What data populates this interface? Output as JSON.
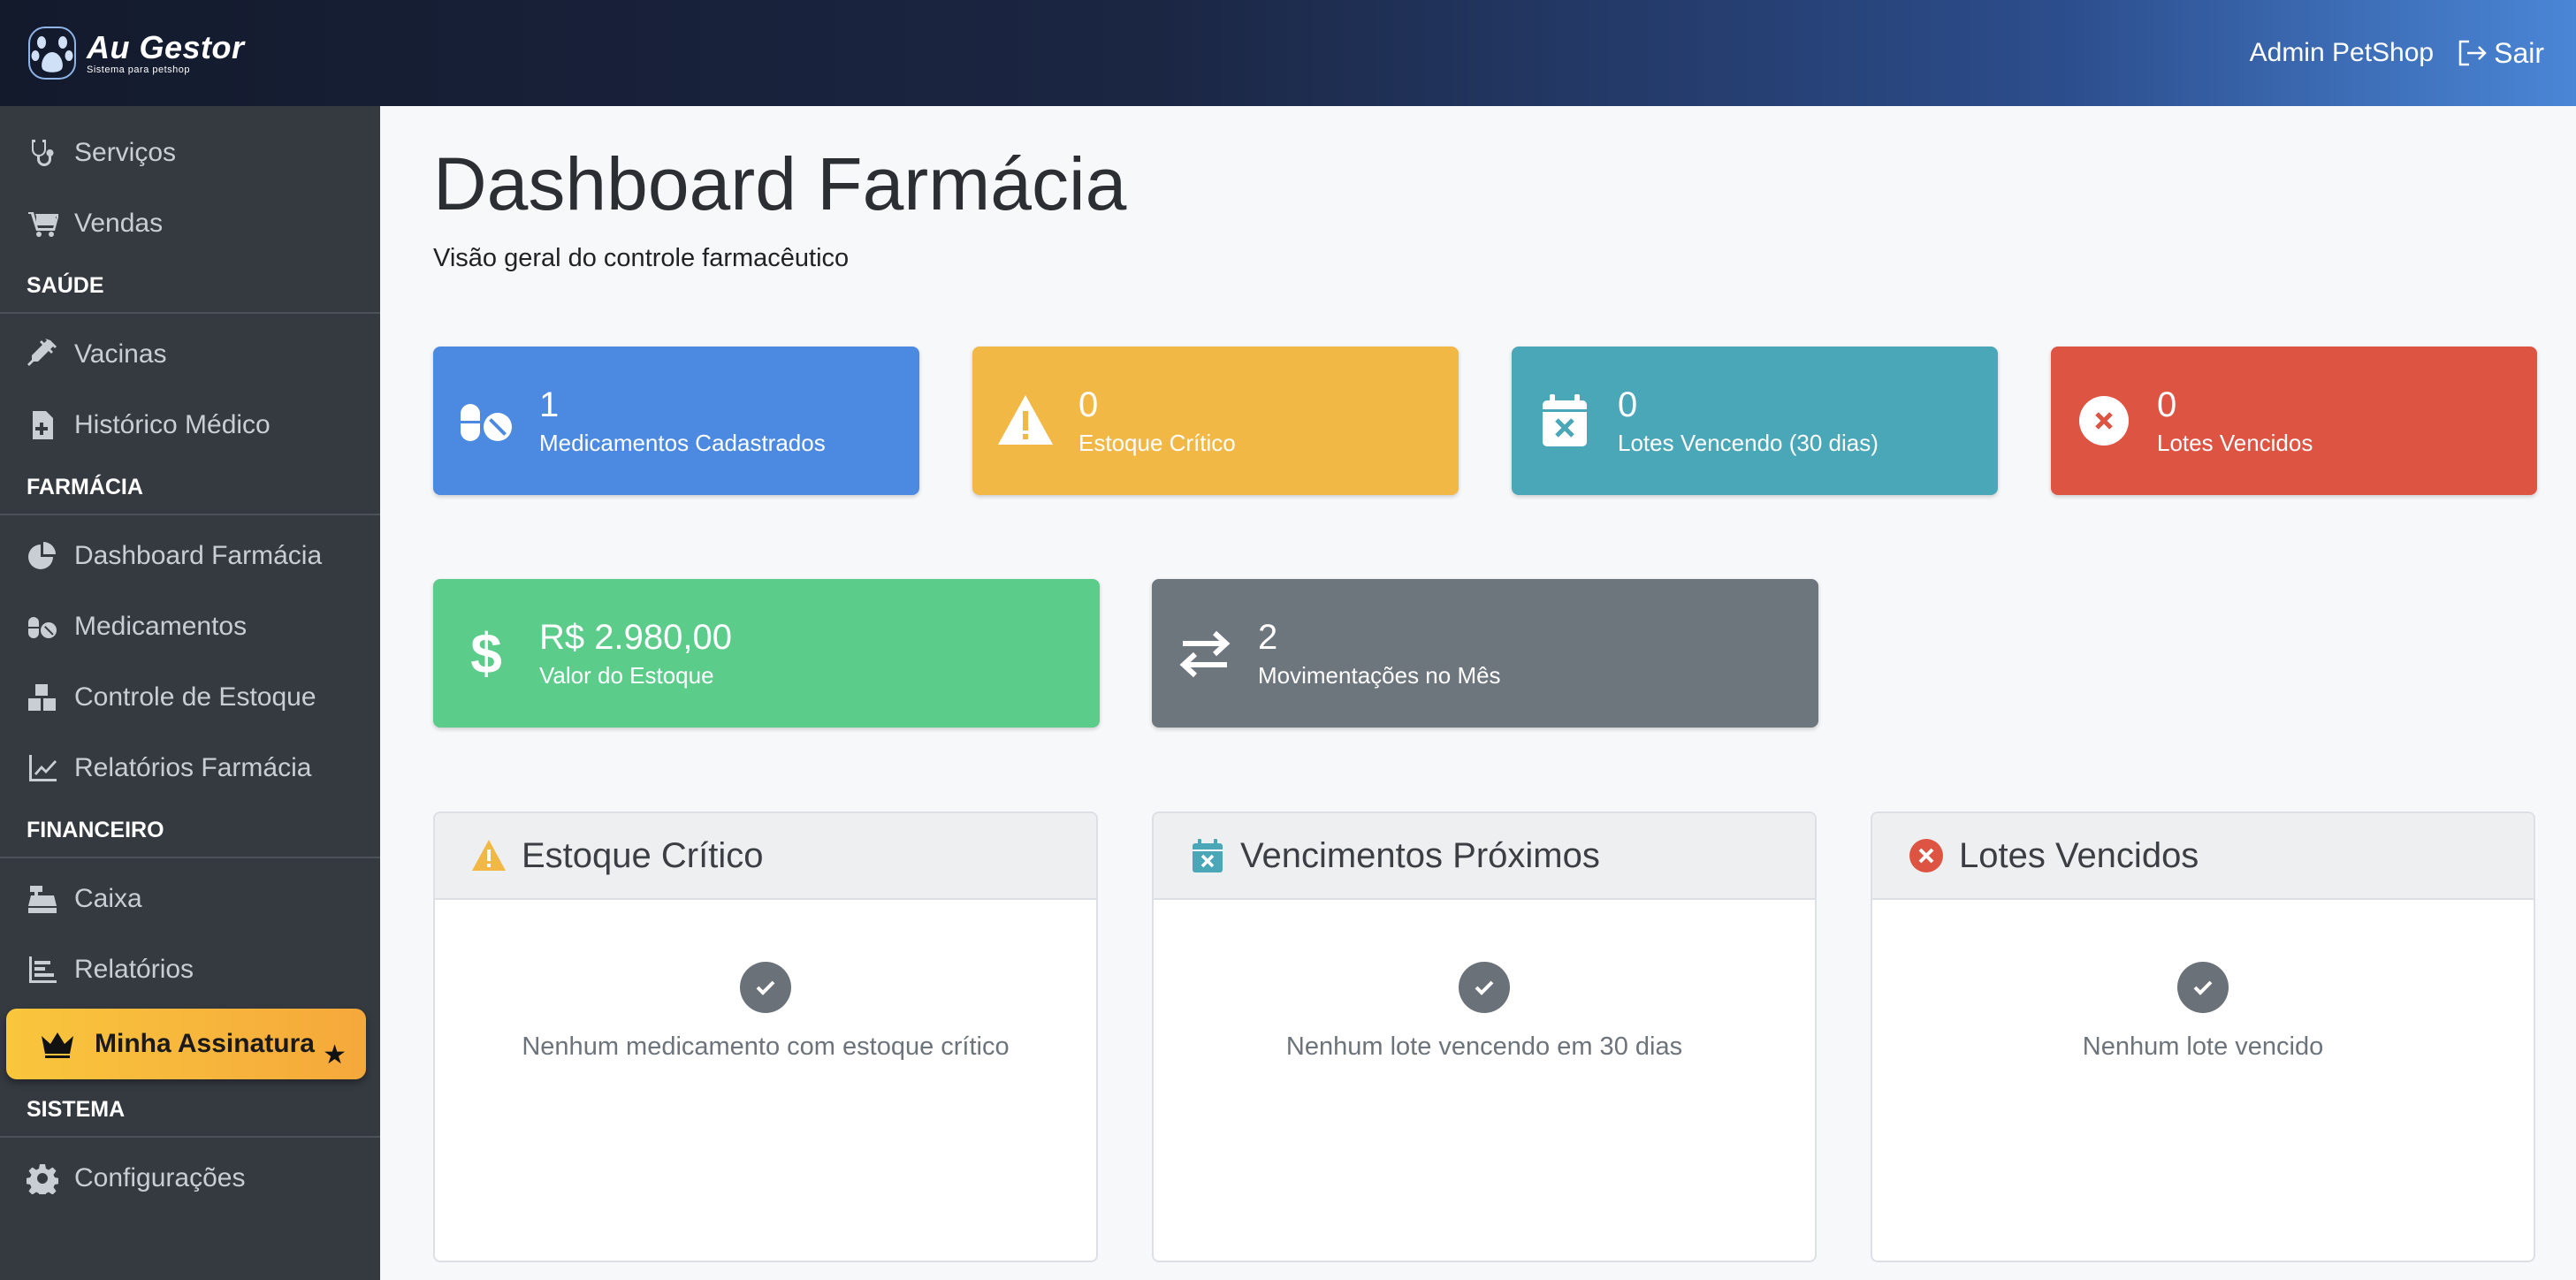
{
  "header": {
    "brand_name": "Au Gestor",
    "brand_tagline": "Sistema para petshop",
    "user_name": "Admin PetShop",
    "logout_label": "Sair"
  },
  "sidebar": {
    "items_top": [
      {
        "label": "Serviços",
        "icon": "stethoscope-icon"
      },
      {
        "label": "Vendas",
        "icon": "cart-icon"
      }
    ],
    "sections": [
      {
        "title": "SAÚDE",
        "items": [
          {
            "label": "Vacinas",
            "icon": "syringe-icon"
          },
          {
            "label": "Histórico Médico",
            "icon": "medical-file-icon"
          }
        ]
      },
      {
        "title": "FARMÁCIA",
        "items": [
          {
            "label": "Dashboard Farmácia",
            "icon": "pie-chart-icon"
          },
          {
            "label": "Medicamentos",
            "icon": "pills-icon"
          },
          {
            "label": "Controle de Estoque",
            "icon": "boxes-icon"
          },
          {
            "label": "Relatórios Farmácia",
            "icon": "line-chart-icon"
          }
        ]
      },
      {
        "title": "FINANCEIRO",
        "items": [
          {
            "label": "Caixa",
            "icon": "cash-register-icon"
          },
          {
            "label": "Relatórios",
            "icon": "bar-chart-icon"
          }
        ]
      },
      {
        "title": "SISTEMA",
        "items": [
          {
            "label": "Configurações",
            "icon": "gear-icon"
          }
        ]
      }
    ],
    "premium": {
      "label": "Minha Assinatura",
      "star": "★"
    }
  },
  "page": {
    "title": "Dashboard Farmácia",
    "subtitle": "Visão geral do controle farmacêutico"
  },
  "stats": [
    {
      "value": "1",
      "label": "Medicamentos Cadastrados",
      "color": "#4b8ae0",
      "icon": "pills-icon"
    },
    {
      "value": "0",
      "label": "Estoque Crítico",
      "color": "#f2b845",
      "icon": "warning-icon"
    },
    {
      "value": "0",
      "label": "Lotes Vencendo (30 dias)",
      "color": "#4aa7b8",
      "icon": "calendar-x-icon"
    },
    {
      "value": "0",
      "label": "Lotes Vencidos",
      "color": "#dd5442",
      "icon": "x-circle-icon"
    },
    {
      "value": "R$ 2.980,00",
      "label": "Valor do Estoque",
      "color": "#5ccc8b",
      "icon": "dollar-icon"
    },
    {
      "value": "2",
      "label": "Movimentações no Mês",
      "color": "#6d757d",
      "icon": "exchange-icon"
    }
  ],
  "panels": [
    {
      "title": "Estoque Crítico",
      "message": "Nenhum medicamento com estoque crítico",
      "icon": "warning-icon",
      "icon_color": "#f2b845"
    },
    {
      "title": "Vencimentos Próximos",
      "message": "Nenhum lote vencendo em 30 dias",
      "icon": "calendar-x-icon",
      "icon_color": "#4aa7b8"
    },
    {
      "title": "Lotes Vencidos",
      "message": "Nenhum lote vencido",
      "icon": "x-circle-icon",
      "icon_color": "#dd5442"
    }
  ]
}
